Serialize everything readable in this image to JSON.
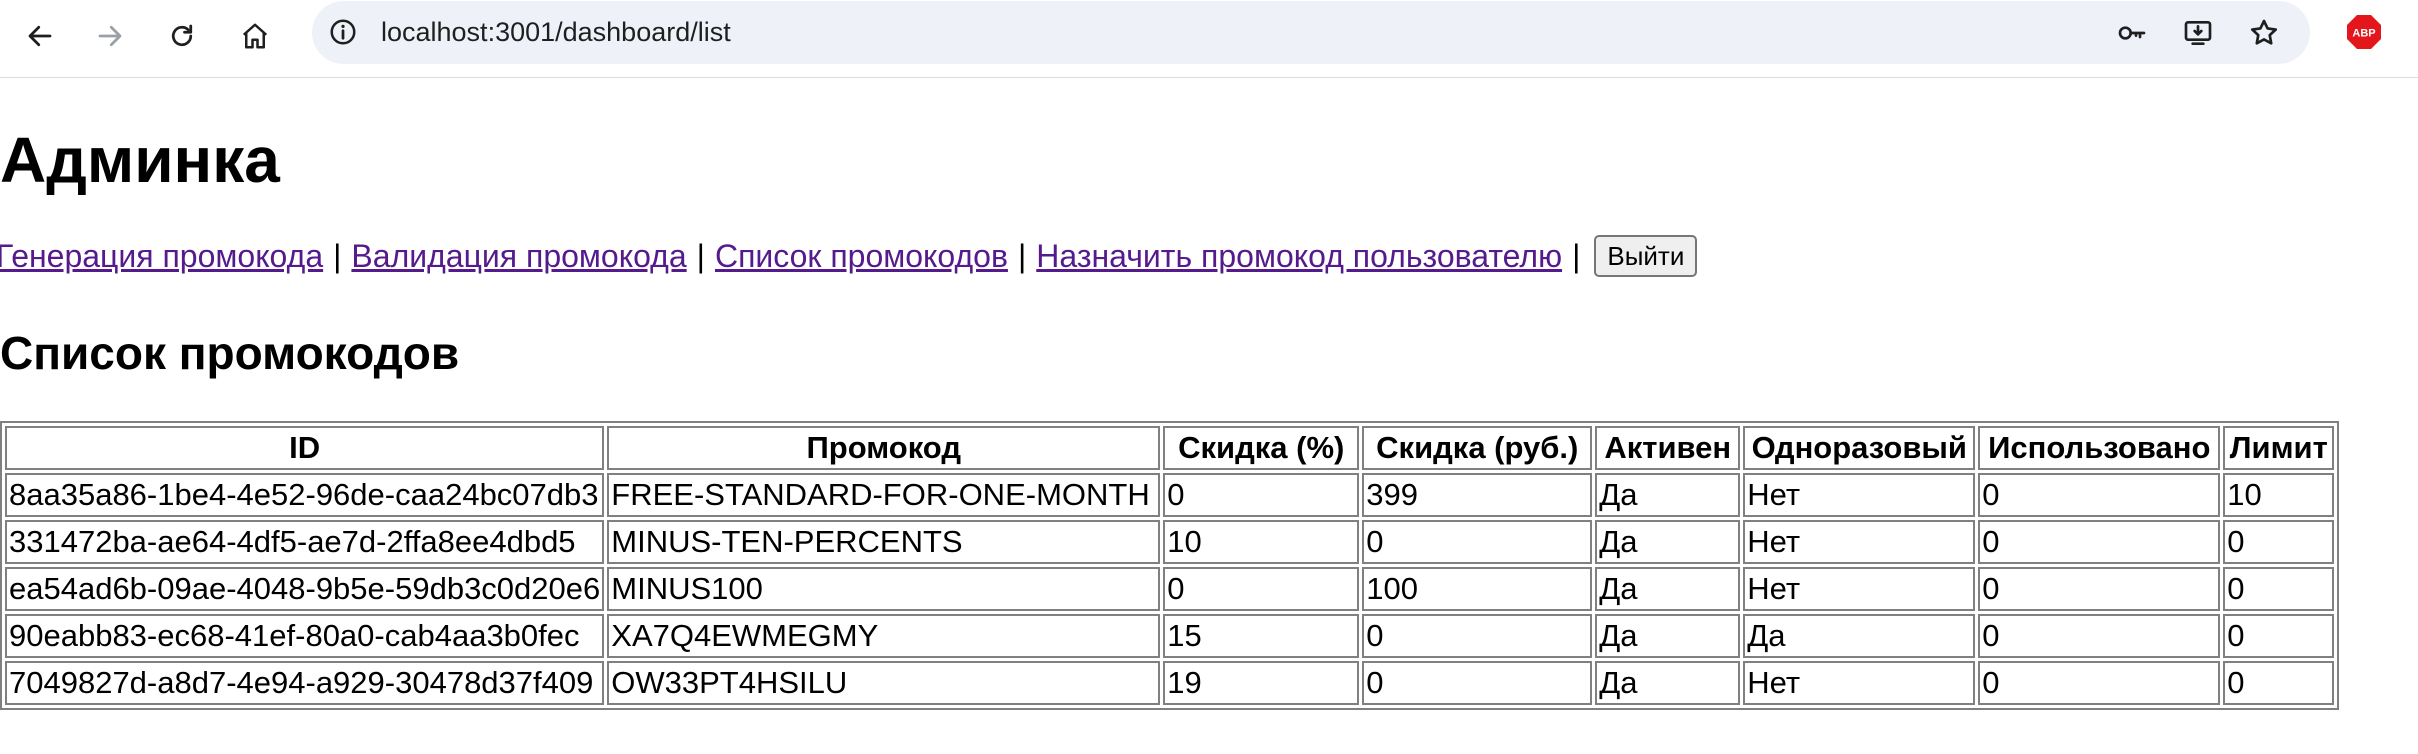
{
  "browser": {
    "url": "localhost:3001/dashboard/list",
    "back_icon": "arrow-left-icon",
    "forward_icon": "arrow-right-icon",
    "reload_icon": "reload-icon",
    "home_icon": "home-icon",
    "site_info_icon": "info-circle-icon",
    "extension_label": "ABP"
  },
  "page": {
    "title": "Админка",
    "nav": {
      "links": [
        "Генерация промокода",
        "Валидация промокода",
        "Список промокодов",
        "Назначить промокод пользователю"
      ],
      "separator": "|",
      "logout_label": "Выйти"
    },
    "section_title": "Список промокодов"
  },
  "table": {
    "headers": [
      "ID",
      "Промокод",
      "Скидка (%)",
      "Скидка (руб.)",
      "Активен",
      "Одноразовый",
      "Использовано",
      "Лимит"
    ],
    "rows": [
      [
        "8aa35a86-1be4-4e52-96de-caa24bc07db3",
        "FREE-STANDARD-FOR-ONE-MONTH",
        "0",
        "399",
        "Да",
        "Нет",
        "0",
        "10"
      ],
      [
        "331472ba-ae64-4df5-ae7d-2ffa8ee4dbd5",
        "MINUS-TEN-PERCENTS",
        "10",
        "0",
        "Да",
        "Нет",
        "0",
        "0"
      ],
      [
        "ea54ad6b-09ae-4048-9b5e-59db3c0d20e6",
        "MINUS100",
        "0",
        "100",
        "Да",
        "Нет",
        "0",
        "0"
      ],
      [
        "90eabb83-ec68-41ef-80a0-cab4aa3b0fec",
        "XA7Q4EWMEGMY",
        "15",
        "0",
        "Да",
        "Да",
        "0",
        "0"
      ],
      [
        "7049827d-a8d7-4e94-a929-30478d37f409",
        "OW33PT4HSILU",
        "19",
        "0",
        "Да",
        "Нет",
        "0",
        "0"
      ]
    ]
  }
}
